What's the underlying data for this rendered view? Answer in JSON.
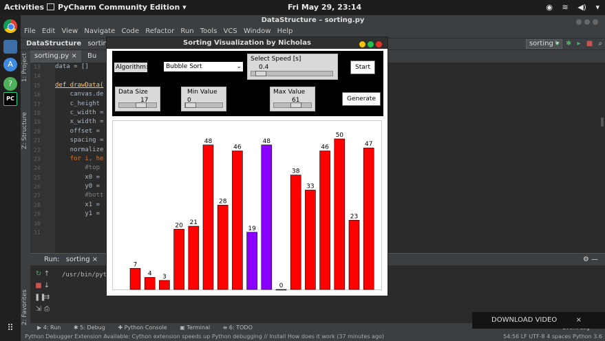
{
  "topbar": {
    "activities": "Activities",
    "app_menu": "PyCharm Community Edition ▾",
    "clock": "Fri May 29, 23:14",
    "tray": [
      "◉",
      "≋",
      "◀)",
      "▾"
    ]
  },
  "dock": {
    "grid_icon": "⠿"
  },
  "ide": {
    "title": "DataStructure – sorting.py",
    "menu": [
      "File",
      "Edit",
      "View",
      "Navigate",
      "Code",
      "Refactor",
      "Run",
      "Tools",
      "VCS",
      "Window",
      "Help"
    ],
    "breadcrumb": {
      "project": "DataStructure",
      "file": "sorting"
    },
    "run_config": "sorting ▾",
    "tabs": [
      {
        "label": "sorting.py ×"
      },
      {
        "label": "Bu"
      }
    ],
    "side_tabs": {
      "project": "1: Project",
      "structure": "Z: Structure",
      "favorites": "2: Favorites"
    },
    "line_numbers": [
      "13",
      "14",
      "15",
      "16",
      "17",
      "18",
      "19",
      "20",
      "21",
      "22",
      "23",
      "24",
      "25",
      "26",
      "27",
      "28",
      "29",
      "30",
      "31"
    ],
    "code_lines": [
      "data = []",
      "",
      "def drawData(",
      "    canvas.de",
      "    c_height",
      "    c_width =",
      "    x_width =",
      "    offset =",
      "    spacing =",
      "    normalize",
      "    for i, he",
      "        #top",
      "        x0 =",
      "        y0 =",
      "        #bott",
      "        x1 =",
      "        y1 =",
      "",
      ""
    ],
    "run": {
      "label": "Run:",
      "config": "sorting ×",
      "output": "/usr/bin/pyth",
      "settings": "⚙ —"
    },
    "bottom_tabs": [
      "▶ 4: Run",
      "✱ 5: Debug",
      "✚ Python Console",
      "▣ Terminal",
      "≡ 6: TODO"
    ],
    "status_left": "Python Debugger Extension Available: Cython extension speeds up Python debugging // Install  How does it work (37 minutes ago)",
    "status_right": "54:56  LF  UTF-8  4 spaces  Python 3.6",
    "event_log": "Event Log"
  },
  "tk": {
    "title": "Sorting Visualization by Nicholas",
    "algorithm_label": "Algorithm:",
    "algorithm_value": "Bubble Sort",
    "speed_label": "Select Speed [s]",
    "speed_value": "0.4",
    "start_label": "Start",
    "data_size_label": "Data Size",
    "data_size_value": "17",
    "min_label": "Min Value",
    "min_value": "0",
    "max_label": "Max Value",
    "max_value": "61",
    "generate_label": "Generate"
  },
  "chart_data": {
    "type": "bar",
    "values": [
      7,
      4,
      3,
      20,
      21,
      48,
      28,
      46,
      19,
      48,
      0,
      38,
      33,
      46,
      50,
      23,
      47
    ],
    "colors": [
      "#ff0000",
      "#ff0000",
      "#ff0000",
      "#ff0000",
      "#ff0000",
      "#ff0000",
      "#ff0000",
      "#ff0000",
      "#8a00ff",
      "#8a00ff",
      "#ff0000",
      "#ff0000",
      "#ff0000",
      "#ff0000",
      "#ff0000",
      "#ff0000",
      "#ff0000"
    ],
    "ymax": 50
  },
  "overlay": {
    "download_label": "DOWNLOAD VIDEO",
    "close_label": "×"
  }
}
